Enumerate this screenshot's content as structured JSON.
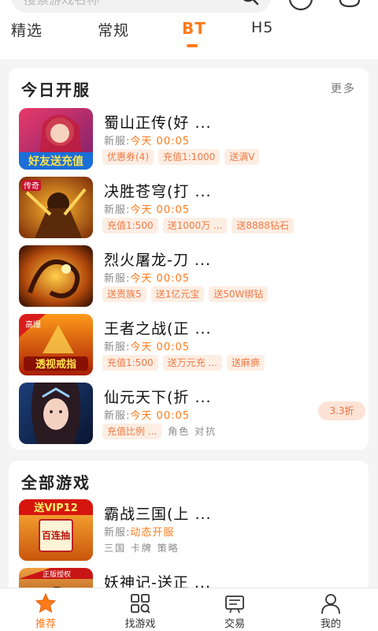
{
  "search": {
    "placeholder": "搜索游戏名称"
  },
  "tabs": [
    {
      "label": "精选"
    },
    {
      "label": "常规"
    },
    {
      "label": "BT",
      "active": true
    },
    {
      "label": "H5"
    }
  ],
  "today_section": {
    "title": "今日开服",
    "more": "更多",
    "games": [
      {
        "name": "蜀山正传(好 ...",
        "open_label": "新服:",
        "day": "今天",
        "time": "00:05",
        "tags": [
          "优惠券(4)",
          "充值1:1000",
          "送满V"
        ],
        "art": "hero-woman-red",
        "thumb_text": "好友送充值"
      },
      {
        "name": "决胜苍穹(打 ...",
        "open_label": "新服:",
        "day": "今天",
        "time": "00:05",
        "tags": [
          "充值1:500",
          "送1000万 ...",
          "送8888钻石"
        ],
        "art": "armored-warrior",
        "thumb_text": "传奇"
      },
      {
        "name": "烈火屠龙-刀 ...",
        "open_label": "新服:",
        "day": "今天",
        "time": "00:05",
        "tags": [
          "送贵族5",
          "送1亿元宝",
          "送50W绑钻"
        ],
        "art": "fire-dragon"
      },
      {
        "name": "王者之战(正 ...",
        "open_label": "新服:",
        "day": "今天",
        "time": "00:05",
        "tags": [
          "充值1:500",
          "送万元充 ...",
          "送麻痹"
        ],
        "art": "fire-battle",
        "thumb_text": "透视戒指",
        "corner": "高爆"
      },
      {
        "name": "仙元天下(折 ...",
        "open_label": "新服:",
        "day": "今天",
        "time": "00:05",
        "tags": [
          "充值比例 ..."
        ],
        "plain_tags": "角色 对抗",
        "discount": "3.3折",
        "art": "fantasy-woman"
      }
    ]
  },
  "all_section": {
    "title": "全部游戏",
    "games": [
      {
        "name": "霸战三国(上 ...",
        "open_label": "新服:",
        "status": "动态开服",
        "plain_tags": "三国 卡牌 策略",
        "art": "three-kingdoms",
        "thumb_text": "送VIP12",
        "thumb_sub": "百连抽"
      },
      {
        "name": "妖神记-送正 ...",
        "art": "demon-god",
        "thumb_text": "正版授权"
      }
    ]
  },
  "bottom_nav": [
    {
      "label": "推荐",
      "icon": "star-icon",
      "active": true
    },
    {
      "label": "找游戏",
      "icon": "grid-search-icon"
    },
    {
      "label": "交易",
      "icon": "trade-icon"
    },
    {
      "label": "我的",
      "icon": "person-icon"
    }
  ],
  "colors": {
    "accent": "#ff7a1a",
    "tag_bg": "#fdeee4",
    "tag_text": "#ee7a45"
  }
}
